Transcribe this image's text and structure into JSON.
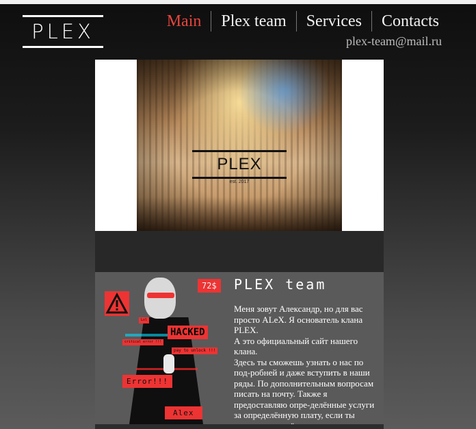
{
  "brand": {
    "logo": "PLEX"
  },
  "nav": {
    "items": [
      {
        "label": "Main",
        "active": true
      },
      {
        "label": "Plex team",
        "active": false
      },
      {
        "label": "Services",
        "active": false
      },
      {
        "label": "Contacts",
        "active": false
      }
    ],
    "email": "plex-team@mail.ru"
  },
  "hero": {
    "logo": "PLEX",
    "est": "est. 2017"
  },
  "about": {
    "title": "PLEX team",
    "paragraphs": [
      "Меня зовут Александр, но для вас просто ALeX. Я основатель клана PLEX.",
      "А это официальный сайт нашего клана.",
      "Здесь ты сможешь узнать о нас по под-робней и даже вступить в наши ряды. По дополнительным вопросам писать на почту. Также я предоставляю опре-делённые услуги за определённую плату, если ты понимаешь о чём я..."
    ],
    "poster": {
      "price": "72$",
      "hacked": "HACKED",
      "small": "Lol",
      "critical": "critical error !!!",
      "pay": "pay to unlock !!!",
      "error": "Error!!!",
      "name": "Alex"
    }
  },
  "colors": {
    "accent": "#e7453d",
    "poster_red": "#ee3333"
  },
  "icons": {
    "warning": "warning-triangle-icon"
  }
}
